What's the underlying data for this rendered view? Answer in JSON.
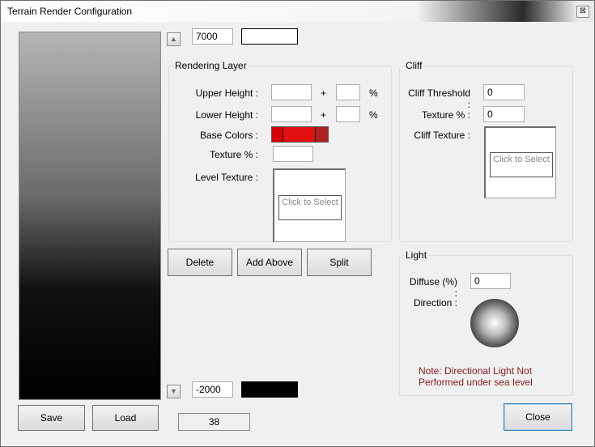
{
  "window": {
    "title": "Terrain Render Configuration",
    "close_glyph": "⊠"
  },
  "top": {
    "max_height": "7000",
    "up_arrow": "▲"
  },
  "bottom": {
    "min_height": "-2000",
    "down_arrow": "▼",
    "status": "38"
  },
  "rendering_layer": {
    "title": "Rendering Layer",
    "upper_height_label": "Upper Height :",
    "upper_height_value": "",
    "upper_pct_value": "",
    "lower_height_label": "Lower Height :",
    "lower_height_value": "",
    "lower_pct_value": "",
    "plus": "+",
    "pct": "%",
    "base_colors_label": "Base Colors :",
    "base_colors": [
      "#d80000",
      "#e01010",
      "#b02020"
    ],
    "texture_label": "Texture % :",
    "texture_value": "",
    "level_texture_label": "Level Texture :",
    "select_label": "Click to Select"
  },
  "layer_buttons": {
    "delete": "Delete",
    "add_above": "Add Above",
    "split": "Split"
  },
  "cliff": {
    "title": "Cliff",
    "threshold_label": "Cliff Threshold :",
    "threshold_value": "0",
    "texture_label": "Texture % :",
    "texture_value": "0",
    "cliff_texture_label": "Cliff Texture :",
    "select_label": "Click to Select"
  },
  "light": {
    "title": "Light",
    "diffuse_label": "Diffuse (%) :",
    "diffuse_value": "0",
    "direction_label": "Direction :",
    "note": "Note: Directional Light Not Performed under sea level"
  },
  "footer": {
    "save": "Save",
    "load": "Load",
    "close": "Close"
  },
  "colors": {
    "top_swatch": "#ffffff",
    "bottom_swatch": "#000000",
    "note": "#8b1a1a"
  }
}
